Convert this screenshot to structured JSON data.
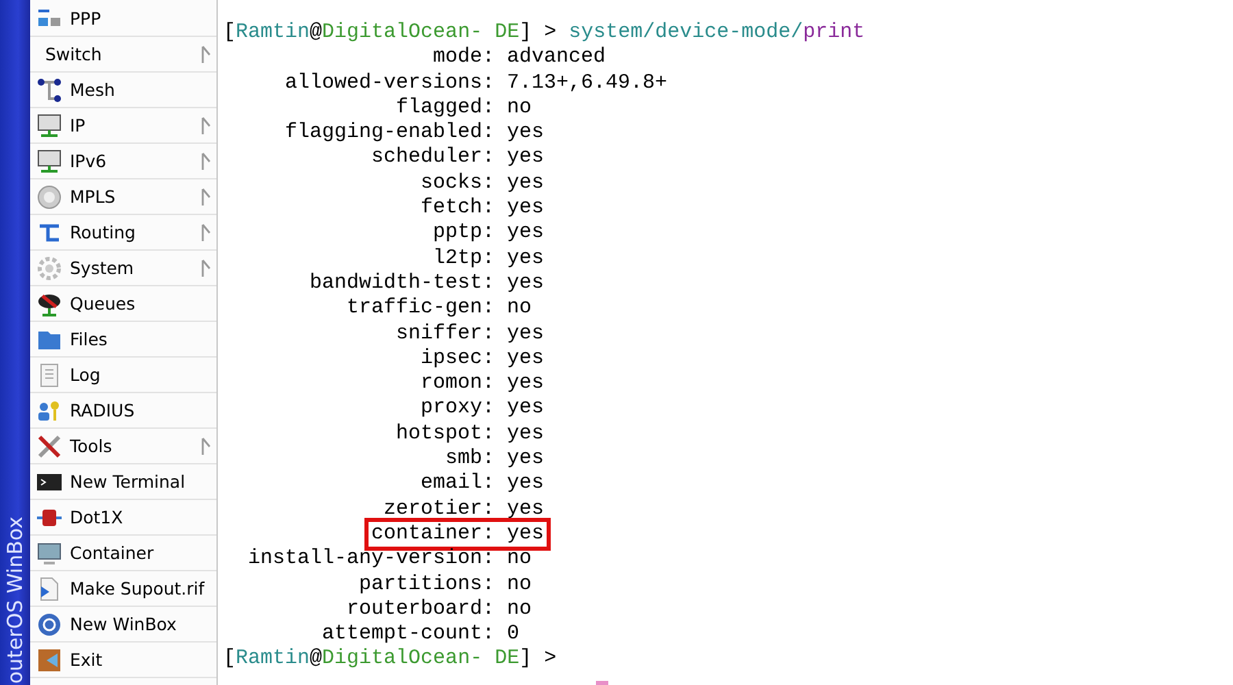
{
  "side_banner": {
    "text": "outerOS WinBox"
  },
  "menu": [
    {
      "label": "PPP",
      "has_submenu": false
    },
    {
      "label": "Switch",
      "has_submenu": true
    },
    {
      "label": "Mesh",
      "has_submenu": false
    },
    {
      "label": "IP",
      "has_submenu": true
    },
    {
      "label": "IPv6",
      "has_submenu": true
    },
    {
      "label": "MPLS",
      "has_submenu": true
    },
    {
      "label": "Routing",
      "has_submenu": true
    },
    {
      "label": "System",
      "has_submenu": true
    },
    {
      "label": "Queues",
      "has_submenu": false
    },
    {
      "label": "Files",
      "has_submenu": false
    },
    {
      "label": "Log",
      "has_submenu": false
    },
    {
      "label": "RADIUS",
      "has_submenu": false
    },
    {
      "label": "Tools",
      "has_submenu": true
    },
    {
      "label": "New Terminal",
      "has_submenu": false
    },
    {
      "label": "Dot1X",
      "has_submenu": false
    },
    {
      "label": "Container",
      "has_submenu": false
    },
    {
      "label": "Make Supout.rif",
      "has_submenu": false
    },
    {
      "label": "New WinBox",
      "has_submenu": false
    },
    {
      "label": "Exit",
      "has_submenu": false
    }
  ],
  "terminal": {
    "lines": [
      {
        "kind": "prompt",
        "parts": [
          {
            "kind": "bracket",
            "text": "["
          },
          {
            "kind": "user",
            "text": "Ramtin"
          },
          {
            "kind": "bracket",
            "text": "@"
          },
          {
            "kind": "host",
            "text": "DigitalOcean- DE"
          },
          {
            "kind": "bracket",
            "text": "] >"
          },
          {
            "kind": "path",
            "text": " system/device-mode/"
          },
          {
            "kind": "action",
            "text": "print"
          }
        ]
      },
      {
        "kind": "field",
        "label": "mode:",
        "value": "advanced",
        "highlighted": false
      },
      {
        "kind": "field",
        "label": "allowed-versions:",
        "value": "7.13+,6.49.8+",
        "highlighted": false
      },
      {
        "kind": "field",
        "label": "flagged:",
        "value": "no",
        "highlighted": false
      },
      {
        "kind": "field",
        "label": "flagging-enabled:",
        "value": "yes",
        "highlighted": false
      },
      {
        "kind": "field",
        "label": "scheduler:",
        "value": "yes",
        "highlighted": false
      },
      {
        "kind": "field",
        "label": "socks:",
        "value": "yes",
        "highlighted": false
      },
      {
        "kind": "field",
        "label": "fetch:",
        "value": "yes",
        "highlighted": false
      },
      {
        "kind": "field",
        "label": "pptp:",
        "value": "yes",
        "highlighted": false
      },
      {
        "kind": "field",
        "label": "l2tp:",
        "value": "yes",
        "highlighted": false
      },
      {
        "kind": "field",
        "label": "bandwidth-test:",
        "value": "yes",
        "highlighted": false
      },
      {
        "kind": "field",
        "label": "traffic-gen:",
        "value": "no",
        "highlighted": false
      },
      {
        "kind": "field",
        "label": "sniffer:",
        "value": "yes",
        "highlighted": false
      },
      {
        "kind": "field",
        "label": "ipsec:",
        "value": "yes",
        "highlighted": false
      },
      {
        "kind": "field",
        "label": "romon:",
        "value": "yes",
        "highlighted": false
      },
      {
        "kind": "field",
        "label": "proxy:",
        "value": "yes",
        "highlighted": false
      },
      {
        "kind": "field",
        "label": "hotspot:",
        "value": "yes",
        "highlighted": false
      },
      {
        "kind": "field",
        "label": "smb:",
        "value": "yes",
        "highlighted": false
      },
      {
        "kind": "field",
        "label": "email:",
        "value": "yes",
        "highlighted": false
      },
      {
        "kind": "field",
        "label": "zerotier:",
        "value": "yes",
        "highlighted": false
      },
      {
        "kind": "field",
        "label": "container:",
        "value": "yes",
        "highlighted": true
      },
      {
        "kind": "field",
        "label": "install-any-version:",
        "value": "no",
        "highlighted": false
      },
      {
        "kind": "field",
        "label": "partitions:",
        "value": "no",
        "highlighted": false
      },
      {
        "kind": "field",
        "label": "routerboard:",
        "value": "no",
        "highlighted": false
      },
      {
        "kind": "field",
        "label": "attempt-count:",
        "value": "0",
        "highlighted": false
      },
      {
        "kind": "prompt",
        "parts": [
          {
            "kind": "bracket",
            "text": "["
          },
          {
            "kind": "user",
            "text": "Ramtin"
          },
          {
            "kind": "bracket",
            "text": "@"
          },
          {
            "kind": "host",
            "text": "DigitalOcean- DE"
          },
          {
            "kind": "bracket",
            "text": "] >"
          }
        ]
      },
      {
        "kind": "cursor"
      }
    ]
  }
}
